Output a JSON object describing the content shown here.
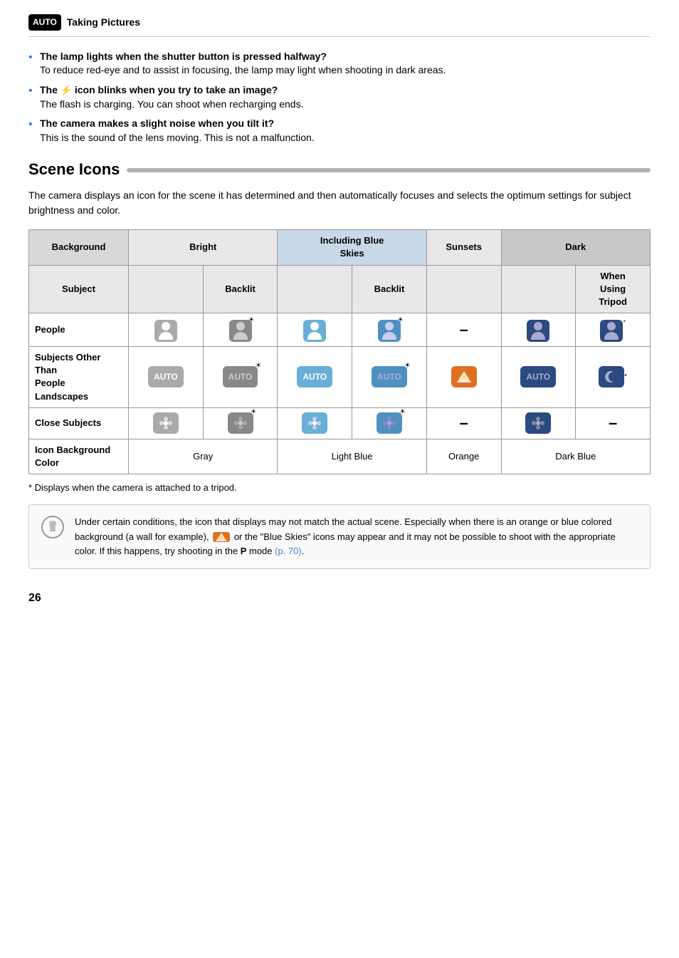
{
  "header": {
    "badge": "AUTO",
    "title": "Taking Pictures"
  },
  "bullets": [
    {
      "bold": "The lamp lights when the shutter button is pressed halfway?",
      "text": "To reduce red-eye and to assist in focusing, the lamp may light when shooting in dark areas."
    },
    {
      "bold": "The ⚡ icon blinks when you try to take an image?",
      "text": "The flash is charging. You can shoot when recharging ends."
    },
    {
      "bold": "The camera makes a slight noise when you tilt it?",
      "text": "This is the sound of the lens moving. This is not a malfunction."
    }
  ],
  "scene_icons": {
    "title": "Scene Icons",
    "description": "The camera displays an icon for the scene it has determined and then automatically focuses and selects the optimum settings for subject brightness and color.",
    "table": {
      "col_headers": {
        "background": "Background",
        "bright": "Bright",
        "including_blue_skies": "Including Blue\nSkies",
        "sunsets": "Sunsets",
        "dark": "Dark"
      },
      "sub_headers": {
        "subject": "Subject",
        "backlit1": "Backlit",
        "backlit2": "Backlit",
        "when_using_tripod": "When\nUsing\nTripod"
      },
      "rows": [
        {
          "label": "People",
          "cells": [
            "person_gray",
            "person_backlit_gray",
            "person_lb",
            "person_backlit_lb",
            "dash",
            "person_db",
            "person_tripod"
          ]
        },
        {
          "label": "Subjects Other Than People Landscapes",
          "cells": [
            "auto_gray",
            "auto_backlit_gray",
            "auto_lb",
            "auto_backlit_lb",
            "landscape_orange",
            "auto_db",
            "moon_db"
          ]
        },
        {
          "label": "Close Subjects",
          "cells": [
            "flower_gray",
            "flower_backlit_gray",
            "flower_lb",
            "flower_backlit_lb",
            "dash",
            "flower_db",
            "dash"
          ]
        },
        {
          "label": "Icon Background Color",
          "cells": [
            "Gray",
            "Light Blue",
            "Orange",
            "Dark Blue"
          ],
          "is_color_row": true
        }
      ]
    },
    "footnote": "* Displays when the camera is attached to a tripod.",
    "note": "Under certain conditions, the icon that displays may not match the actual scene. Especially when there is an orange or blue colored background (a wall for example),  or the \"Blue Skies\" icons may appear and it may not be possible to shoot with the appropriate color. If this happens, try shooting in the P mode (p. 70).",
    "note_page_link": "p. 70"
  },
  "page_number": "26"
}
